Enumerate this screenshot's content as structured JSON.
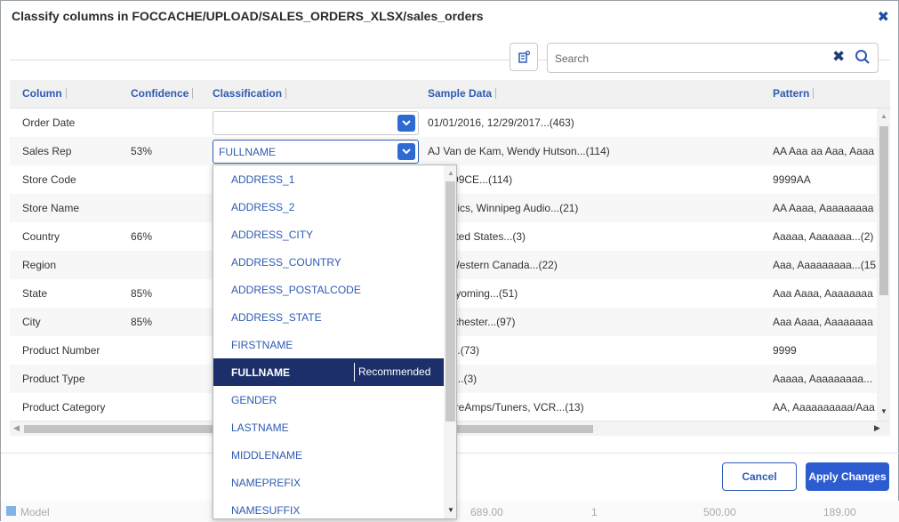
{
  "dialog": {
    "title": "Classify columns in FOCCACHE/UPLOAD/SALES_ORDERS_XLSX/sales_orders",
    "close_icon": "close-icon"
  },
  "toolbar": {
    "search_placeholder": "Search",
    "settings_icon": "column-settings-icon",
    "clear_icon": "clear-icon",
    "search_icon": "search-icon"
  },
  "grid": {
    "headers": [
      "Column",
      "Confidence",
      "Classification",
      "Sample Data",
      "Pattern"
    ],
    "rows": [
      {
        "column": "Order Date",
        "confidence": "",
        "classification": "",
        "sample": "01/01/2016, 12/29/2017...(463)",
        "pattern": ""
      },
      {
        "column": "Sales Rep",
        "confidence": "53%",
        "classification": "FULLNAME",
        "sample": "AJ Van de Kam, Wendy Hutson...(114)",
        "pattern": "AA Aaa aa Aaa, Aaaa"
      },
      {
        "column": "Store Code",
        "confidence": "",
        "classification": "",
        "sample": "A, 9999CE...(114)",
        "pattern": "9999AA"
      },
      {
        "column": "Store Name",
        "confidence": "",
        "classification": "",
        "sample": "ectronics, Winnipeg Audio...(21)",
        "pattern": "AA Aaaa, Aaaaaaaaa"
      },
      {
        "column": "Country",
        "confidence": "66%",
        "classification": "",
        "sample": "a, United States...(3)",
        "pattern": "Aaaaa, Aaaaaaa...(2)"
      },
      {
        "column": "Region",
        "confidence": "",
        "classification": "",
        "sample": "icia, Western Canada...(22)",
        "pattern": "Aaa, Aaaaaaaaa...(15"
      },
      {
        "column": "State",
        "confidence": "85%",
        "classification": "",
        "sample": "na, Wyoming...(51)",
        "pattern": "Aaa Aaaa, Aaaaaaaa"
      },
      {
        "column": "City",
        "confidence": "85%",
        "classification": "",
        "sample": "; Worchester...(97)",
        "pattern": "Aaa Aaaa, Aaaaaaaa"
      },
      {
        "column": "Product Number",
        "confidence": "",
        "classification": "",
        "sample": "5015...(73)",
        "pattern": "9999"
      },
      {
        "column": "Product Type",
        "confidence": "",
        "classification": "",
        "sample": "Video...(3)",
        "pattern": "Aaaaa, Aaaaaaaaa..."
      },
      {
        "column": "Product Category",
        "confidence": "",
        "classification": "",
        "sample": "iers/PreAmps/Tuners, VCR...(13)",
        "pattern": "AA, Aaaaaaaaaa/Aaa"
      }
    ]
  },
  "dropdown": {
    "items": [
      "ADDRESS_1",
      "ADDRESS_2",
      "ADDRESS_CITY",
      "ADDRESS_COUNTRY",
      "ADDRESS_POSTALCODE",
      "ADDRESS_STATE",
      "FIRSTNAME",
      "FULLNAME",
      "GENDER",
      "LASTNAME",
      "MIDDLENAME",
      "NAMEPREFIX",
      "NAMESUFFIX"
    ],
    "selected_index": 7,
    "recommended_label": "Recommended"
  },
  "footer": {
    "cancel_label": "Cancel",
    "apply_label": "Apply Changes"
  },
  "background": {
    "label": "Model",
    "values": [
      "689.00",
      "1",
      "500.00",
      "189.00"
    ]
  },
  "colors": {
    "accent": "#2d5bd0",
    "link": "#2d5bb3",
    "selected_bg": "#1c2f6b"
  }
}
